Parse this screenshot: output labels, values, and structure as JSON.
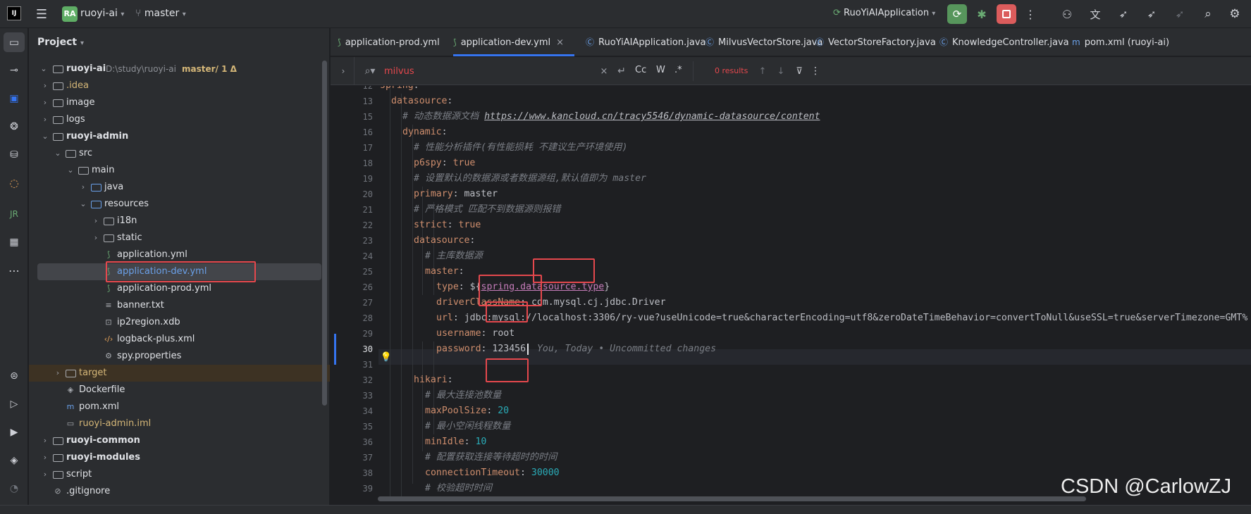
{
  "titlebar": {
    "project_badge": "RA",
    "project_name": "ruoyi-ai",
    "branch": "master",
    "run_config": "RuoYiAIApplication"
  },
  "project_panel": {
    "title": "Project",
    "root_name": "ruoyi-ai",
    "root_path": "D:\\study\\ruoyi-ai",
    "root_branch": "master/ 1 Δ",
    "items": [
      {
        "label": ".idea",
        "kind": "folder",
        "color": "#d5b778"
      },
      {
        "label": "image",
        "kind": "folder"
      },
      {
        "label": "logs",
        "kind": "folder"
      },
      {
        "label": "ruoyi-admin",
        "kind": "module"
      },
      {
        "label": "src",
        "kind": "folder"
      },
      {
        "label": "main",
        "kind": "folder"
      },
      {
        "label": "java",
        "kind": "folder"
      },
      {
        "label": "resources",
        "kind": "folder"
      },
      {
        "label": "i18n",
        "kind": "folder"
      },
      {
        "label": "static",
        "kind": "folder"
      },
      {
        "label": "application.yml",
        "kind": "yml"
      },
      {
        "label": "application-dev.yml",
        "kind": "yml",
        "selected": true
      },
      {
        "label": "application-prod.yml",
        "kind": "yml"
      },
      {
        "label": "banner.txt",
        "kind": "txt"
      },
      {
        "label": "ip2region.xdb",
        "kind": "bin"
      },
      {
        "label": "logback-plus.xml",
        "kind": "xml"
      },
      {
        "label": "spy.properties",
        "kind": "props"
      },
      {
        "label": "target",
        "kind": "folder",
        "color": "#d5b778"
      },
      {
        "label": "Dockerfile",
        "kind": "docker"
      },
      {
        "label": "pom.xml",
        "kind": "maven"
      },
      {
        "label": "ruoyi-admin.iml",
        "kind": "iml",
        "color": "#d5b778"
      },
      {
        "label": "ruoyi-common",
        "kind": "module"
      },
      {
        "label": "ruoyi-modules",
        "kind": "module"
      },
      {
        "label": "script",
        "kind": "folder"
      },
      {
        "label": ".gitignore",
        "kind": "ignore"
      }
    ]
  },
  "tabs": [
    {
      "label": "application-prod.yml"
    },
    {
      "label": "application-dev.yml",
      "active": true
    },
    {
      "label": "RuoYiAIApplication.java"
    },
    {
      "label": "MilvusVectorStore.java"
    },
    {
      "label": "VectorStoreFactory.java"
    },
    {
      "label": "KnowledgeController.java"
    },
    {
      "label": "pom.xml (ruoyi-ai)"
    }
  ],
  "search": {
    "query": "milvus",
    "opt_case": "Cc",
    "opt_word": "W",
    "opt_regex": ".*",
    "results": "0 results"
  },
  "code": {
    "line_numbers": [
      "12",
      "13",
      "15",
      "16",
      "17",
      "18",
      "19",
      "20",
      "21",
      "22",
      "23",
      "24",
      "25",
      "26",
      "27",
      "28",
      "29",
      "30",
      "31",
      "32",
      "33",
      "34",
      "35",
      "36",
      "37",
      "38",
      "39"
    ],
    "l12_key": "spring",
    "l13_key": "datasource",
    "l15_comment": "# 动态数据源文档 ",
    "l15_link": "https://www.kancloud.cn/tracy5546/dynamic-datasource/content",
    "l16_key": "dynamic",
    "l17_comment": "# 性能分析插件(有性能损耗 不建议生产环境使用)",
    "l18_key": "p6spy",
    "l18_val": "true",
    "l19_comment": "# 设置默认的数据源或者数据源组,默认值即为 master",
    "l20_key": "primary",
    "l20_val": "master",
    "l21_comment": "# 严格模式 匹配不到数据源则报错",
    "l22_key": "strict",
    "l22_val": "true",
    "l23_key": "datasource",
    "l24_comment": "# 主库数据源",
    "l25_key": "master",
    "l26_key": "type",
    "l26_pre": "${",
    "l26_ref": "spring.datasource.type",
    "l26_post": "}",
    "l27_key": "driverClassName",
    "l27_val": "com.mysql.cj.jdbc.Driver",
    "l28_key": "url",
    "l28_val": "jdbc:mysql://localhost:3306/ry-vue?useUnicode=true&characterEncoding=utf8&zeroDateTimeBehavior=convertToNull&useSSL=true&serverTimezone=GMT%",
    "l29_key": "username",
    "l29_val": "root",
    "l30_key": "password",
    "l30_val": "123456",
    "l30_blame": "You, Today • Uncommitted changes",
    "l32_key": "hikari",
    "l33_comment": "# 最大连接池数量",
    "l34_key": "maxPoolSize",
    "l34_val": "20",
    "l35_comment": "# 最小空闲线程数量",
    "l36_key": "minIdle",
    "l36_val": "10",
    "l37_comment": "# 配置获取连接等待超时的时间",
    "l38_key": "connectionTimeout",
    "l38_val": "30000",
    "l39_comment": "# 校验超时时间"
  },
  "watermark": "CSDN @CarlowZJ",
  "colors": {
    "accent": "#3574f0",
    "highlight_box": "#e5484d",
    "run_green": "#57965c",
    "stop_red": "#db5c5c"
  }
}
